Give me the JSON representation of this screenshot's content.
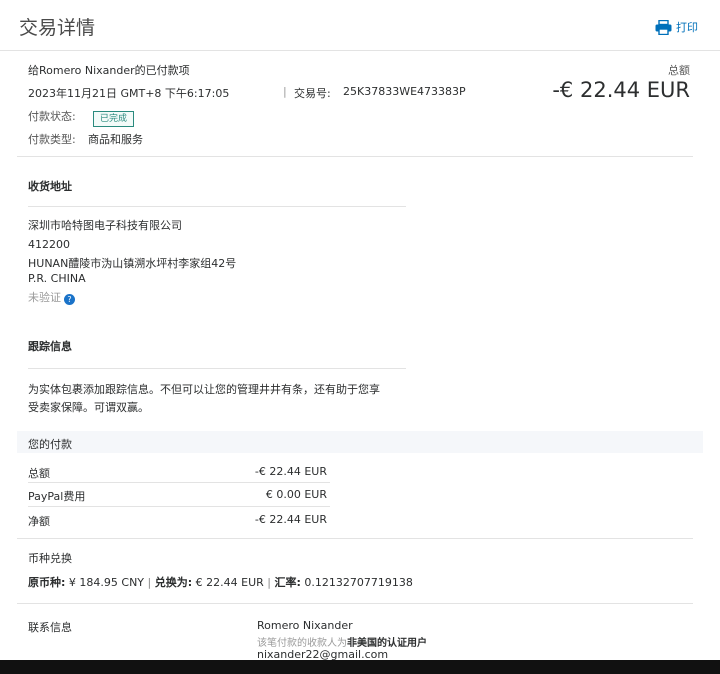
{
  "header": {
    "title": "交易详情",
    "print_label": "打印",
    "print_icon": "printer-icon"
  },
  "summary": {
    "payee_line": "给Romero Nixander的已付款项",
    "datetime": "2023年11月21日 GMT+8 下午6:17:05",
    "txn_label": "交易号:",
    "txn_id": "25K37833WE473383P",
    "total_label": "总额",
    "total_amount": "-€ 22.44 EUR",
    "status_label": "付款状态:",
    "status_value": "已完成",
    "type_label": "付款类型:",
    "type_value": "商品和服务"
  },
  "shipping": {
    "title": "收货地址",
    "company": "深圳市哈特图电子科技有限公司",
    "postcode": "412200",
    "address": "HUNAN醴陵市沩山镇溯水坪村李家组42号",
    "country": "P.R. CHINA",
    "verify_status": "未验证"
  },
  "tracking": {
    "title": "跟踪信息",
    "text_line1": "为实体包裹添加跟踪信息。不但可以让您的管理井井有条，还有助于您享",
    "text_line2": "受卖家保障。可谓双赢。"
  },
  "payment": {
    "title": "您的付款",
    "rows": [
      {
        "label": "总额",
        "value": "-€ 22.44 EUR"
      },
      {
        "label": "PayPal费用",
        "value": "€ 0.00 EUR"
      },
      {
        "label": "净额",
        "value": "-€ 22.44 EUR"
      }
    ]
  },
  "currency": {
    "title": "币种兑换",
    "original_label": "原币种:",
    "original_value": "¥ 184.95 CNY",
    "converted_label": "兑换为:",
    "converted_value": "€ 22.44 EUR",
    "rate_label": "汇率:",
    "rate_value": "0.12132707719138",
    "separator": "|"
  },
  "contact": {
    "title": "联系信息",
    "name": "Romero Nixander",
    "note_prefix": "该笔付款的收款人为",
    "note_bold": "非美国的认证用户",
    "email": "nixander22@gmail.com"
  }
}
